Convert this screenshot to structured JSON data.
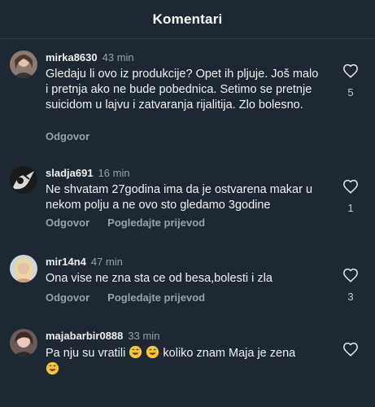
{
  "header": {
    "title": "Komentari"
  },
  "actions": {
    "reply": "Odgovor",
    "translate": "Pogledajte prijevod"
  },
  "comments": [
    {
      "username": "mirka8630",
      "time": "43 min",
      "text": "Gledaju li ovo iz produkcije? Opet ih pljuje. Još malo i pretnja ako ne bude pobednica. Setimo se pretnje suicidom u lajvu i zatvaranja rijalitija. Zlo bolesno.",
      "likes": "5"
    },
    {
      "username": "sladja691",
      "time": "16 min",
      "text": "Ne shvatam 27godina ima da je ostvarena makar u nekom polju a ne ovo sto gledamo 3godine",
      "likes": "1"
    },
    {
      "username": "mir14n4",
      "time": "47 min",
      "text": "Ona vise ne zna sta ce od besa,bolesti i zla",
      "likes": "3"
    },
    {
      "username": "majabarbir0888",
      "time": "33 min",
      "text_part1": "Pa nju su vratili",
      "text_part2": "koliko znam Maja je zena",
      "emoji": "grinning-sweat-emoji"
    }
  ],
  "colors": {
    "background": "#1e2832",
    "text": "#f2f2f2",
    "muted": "#98a1a9"
  }
}
